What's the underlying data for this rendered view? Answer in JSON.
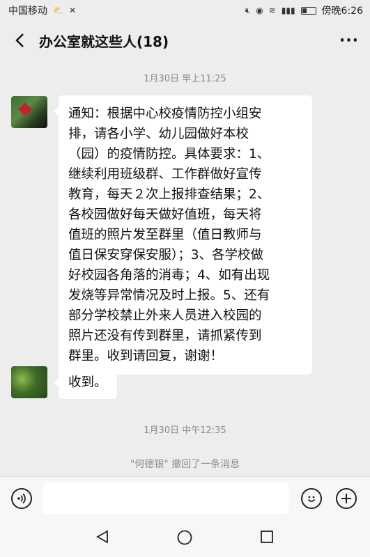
{
  "status_bar": {
    "carrier": "中国移动",
    "time": "傍晚6:26"
  },
  "header": {
    "title": "办公室就这些人(18)",
    "more_label": "···"
  },
  "messages": {
    "timestamp_1": "1月30日 早上11:25",
    "notice_lines": [
      "通知：根据中心校疫情防控小组安",
      "排，请各小学、幼儿园做好本校",
      "（园）的疫情防控。具体要求：1、",
      "继续利用班级群、工作群做好宣传",
      "教育，每天２次上报排查结果；2、",
      "各校园做好每天做好值班，每天将",
      "值班的照片发至群里（值日教师与",
      "值日保安穿保安服）；3、各学校做",
      "好校园各角落的消毒；4、如有出现",
      "发烧等异常情况及时上报。5、还有",
      "部分学校禁止外来人员进入校园的",
      "照片还没有传到群里，请抓紧传到",
      "群里。收到请回复，谢谢！"
    ],
    "reply": "收到。",
    "timestamp_2": "1月30日 中午12:35",
    "recall_notice": "\"何德银\" 撤回了一条消息"
  },
  "input_bar": {
    "value": ""
  },
  "icons": {
    "back": "chevron-left-icon",
    "more": "more-dots-icon",
    "voice": "voice-icon",
    "emoji": "emoji-icon",
    "plus": "plus-icon"
  }
}
